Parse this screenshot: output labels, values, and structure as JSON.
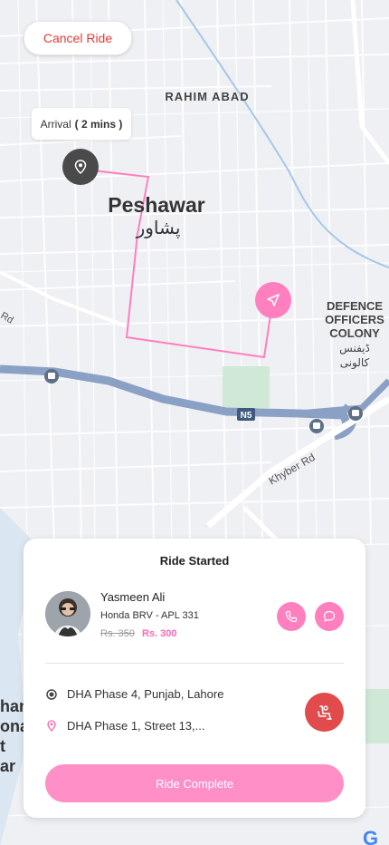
{
  "map": {
    "labels": {
      "rahim_abad": "RAHIM ABAD",
      "peshawar": "Peshawar",
      "peshawar_urdu": "پشاور",
      "defence_1": "DEFENCE",
      "defence_2": "OFFICERS",
      "defence_3": "COLONY",
      "defence_urdu_1": "ڈیفنس",
      "defence_urdu_2": "کالونی",
      "n5": "N5",
      "khyber_rd": "Khyber Rd",
      "rd_left": "Rd",
      "g_logo": "G",
      "left_edge_1": "han",
      "left_edge_2": "ona",
      "left_edge_3": "t",
      "left_edge_4": "ar"
    },
    "route_color": "#ff7fbf"
  },
  "header": {
    "cancel_label": "Cancel Ride"
  },
  "arrival": {
    "label": "Arrival",
    "time": "( 2 mins )"
  },
  "card": {
    "title": "Ride Started",
    "driver": {
      "name": "Yasmeen Ali",
      "car": "Honda BRV - APL 331",
      "price_old": "Rs. 350",
      "price_new": "Rs. 300"
    },
    "pickup": "DHA Phase 4, Punjab, Lahore",
    "dropoff": "DHA Phase 1, Street 13,...",
    "complete_label": "Ride Complete"
  },
  "colors": {
    "accent": "#ff7fbf",
    "danger": "#e14b4b",
    "cancel_text": "#e53935"
  },
  "icons": [
    "location-pin-icon",
    "navigation-arrow-icon",
    "phone-icon",
    "chat-icon",
    "radio-dot-icon",
    "location-marker-icon",
    "emergency-seat-icon",
    "bus-stop-icon"
  ]
}
